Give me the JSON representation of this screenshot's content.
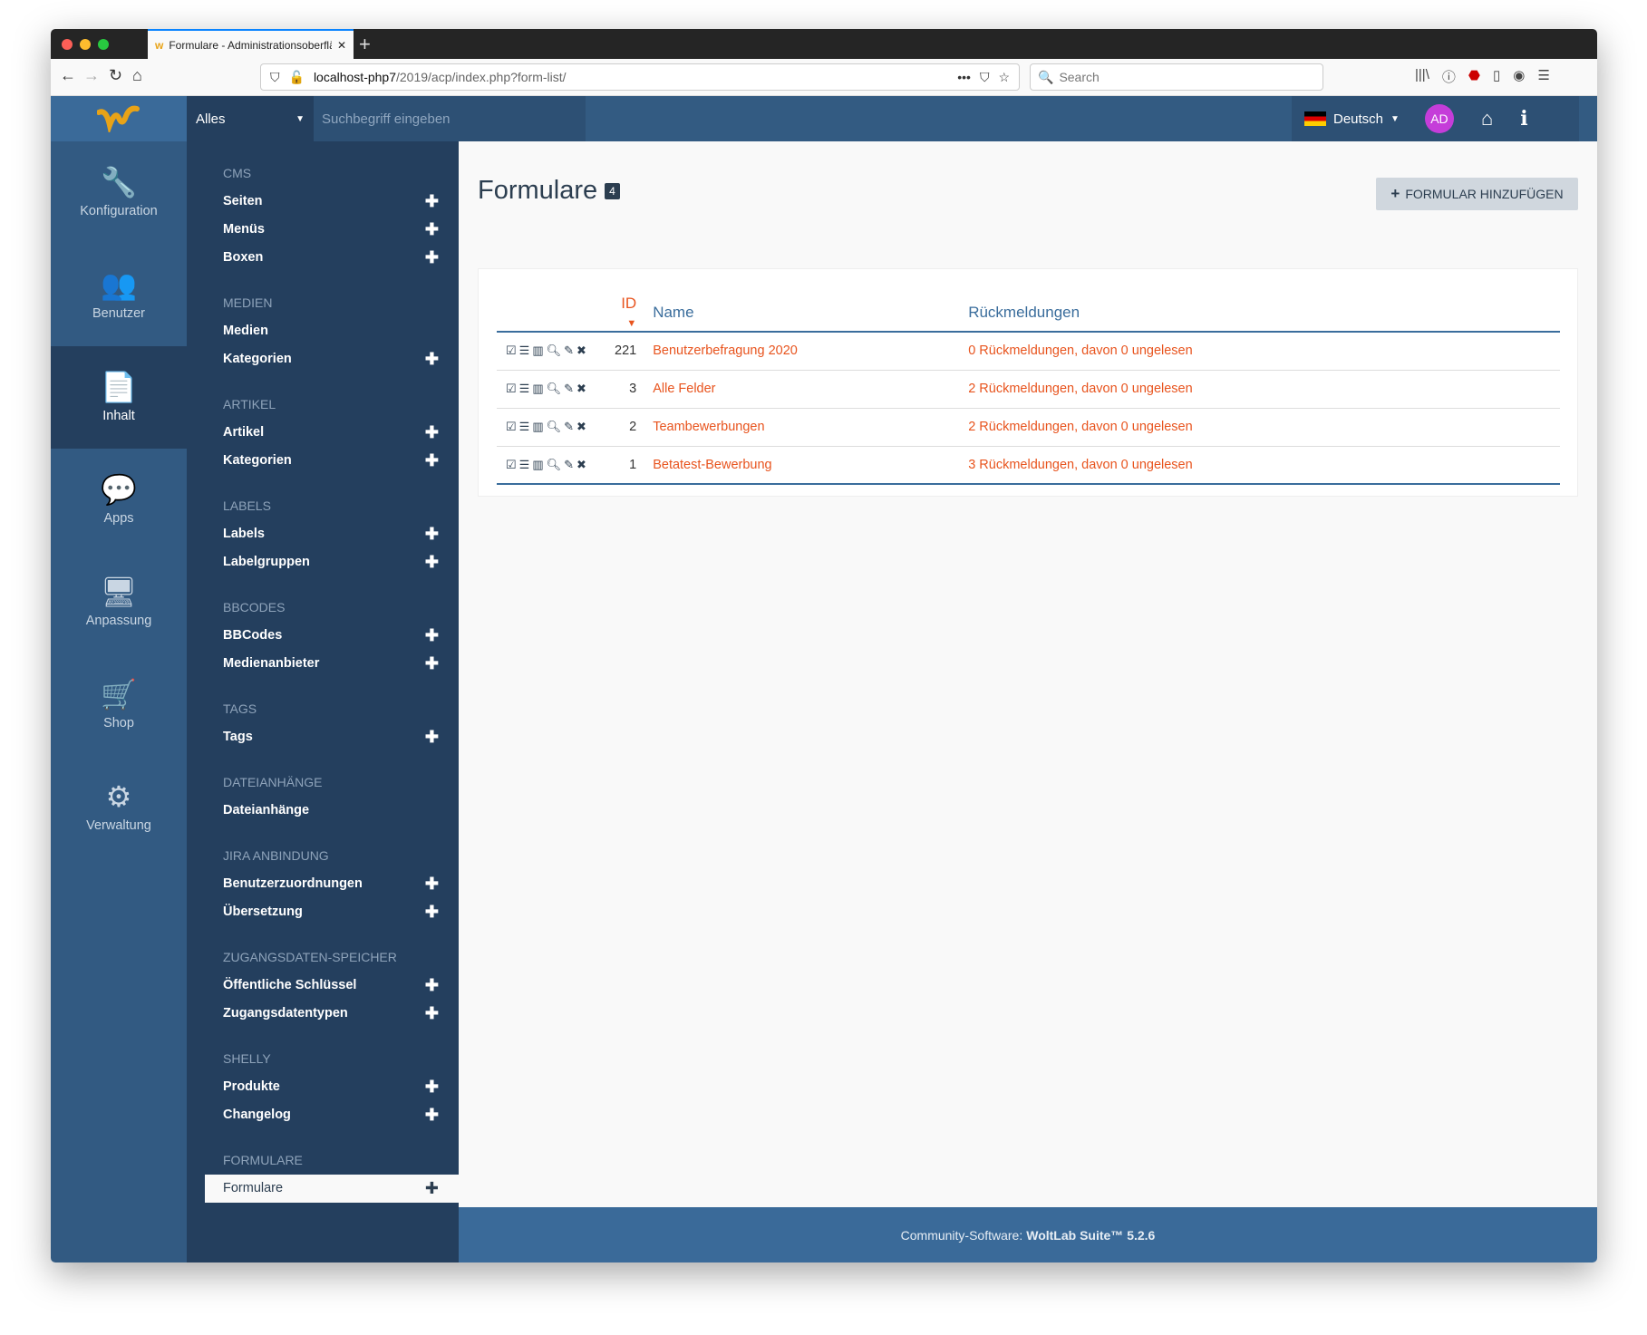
{
  "browser": {
    "tab_title": "Formulare - Administrationsoberfläche",
    "url_host": "localhost-php7",
    "url_path": "/2019/acp/index.php?form-list/",
    "search_placeholder": "Search"
  },
  "header": {
    "scope": "Alles",
    "search_placeholder": "Suchbegriff eingeben",
    "language": "Deutsch",
    "avatar": "AD"
  },
  "sidebar": {
    "items": [
      {
        "label": "Konfiguration",
        "icon": "🔧"
      },
      {
        "label": "Benutzer",
        "icon": "👥"
      },
      {
        "label": "Inhalt",
        "icon": "📄",
        "active": true
      },
      {
        "label": "Apps",
        "icon": "💬"
      },
      {
        "label": "Anpassung",
        "icon": "🖥"
      },
      {
        "label": "Shop",
        "icon": "🛒"
      },
      {
        "label": "Verwaltung",
        "icon": "⚙"
      }
    ]
  },
  "submenu": [
    {
      "title": "CMS",
      "items": [
        {
          "label": "Seiten",
          "add": true
        },
        {
          "label": "Menüs",
          "add": true
        },
        {
          "label": "Boxen",
          "add": true
        }
      ]
    },
    {
      "title": "Medien",
      "items": [
        {
          "label": "Medien",
          "add": false
        },
        {
          "label": "Kategorien",
          "add": true
        }
      ]
    },
    {
      "title": "Artikel",
      "items": [
        {
          "label": "Artikel",
          "add": true
        },
        {
          "label": "Kategorien",
          "add": true
        }
      ]
    },
    {
      "title": "Labels",
      "items": [
        {
          "label": "Labels",
          "add": true
        },
        {
          "label": "Labelgruppen",
          "add": true
        }
      ]
    },
    {
      "title": "BBCodes",
      "items": [
        {
          "label": "BBCodes",
          "add": true
        },
        {
          "label": "Medienanbieter",
          "add": true
        }
      ]
    },
    {
      "title": "Tags",
      "items": [
        {
          "label": "Tags",
          "add": true
        }
      ]
    },
    {
      "title": "Dateianhänge",
      "items": [
        {
          "label": "Dateianhänge",
          "add": false
        }
      ]
    },
    {
      "title": "Jira Anbindung",
      "items": [
        {
          "label": "Benutzerzuordnungen",
          "add": true
        },
        {
          "label": "Übersetzung",
          "add": true
        }
      ]
    },
    {
      "title": "Zugangsdaten-Speicher",
      "items": [
        {
          "label": "Öffentliche Schlüssel",
          "add": true
        },
        {
          "label": "Zugangsdatentypen",
          "add": true
        }
      ]
    },
    {
      "title": "Shelly",
      "items": [
        {
          "label": "Produkte",
          "add": true
        },
        {
          "label": "Changelog",
          "add": true
        }
      ]
    },
    {
      "title": "Formulare",
      "items": [
        {
          "label": "Formulare",
          "add": true,
          "active": true
        }
      ]
    }
  ],
  "main": {
    "title": "Formulare",
    "count": "4",
    "add_button": "FORMULAR HINZUFÜGEN",
    "columns": {
      "id": "ID",
      "name": "Name",
      "responses": "Rückmeldungen"
    },
    "rows": [
      {
        "id": "221",
        "name": "Benutzerbefragung 2020",
        "responses": "0 Rückmeldungen, davon 0 ungelesen"
      },
      {
        "id": "3",
        "name": "Alle Felder",
        "responses": "2 Rückmeldungen, davon 0 ungelesen"
      },
      {
        "id": "2",
        "name": "Teambewerbungen",
        "responses": "2 Rückmeldungen, davon 0 ungelesen"
      },
      {
        "id": "1",
        "name": "Betatest-Bewerbung",
        "responses": "3 Rückmeldungen, davon 0 ungelesen"
      }
    ]
  },
  "footer": {
    "prefix": "Community-Software:",
    "product": "WoltLab Suite™ 5.2.6"
  }
}
